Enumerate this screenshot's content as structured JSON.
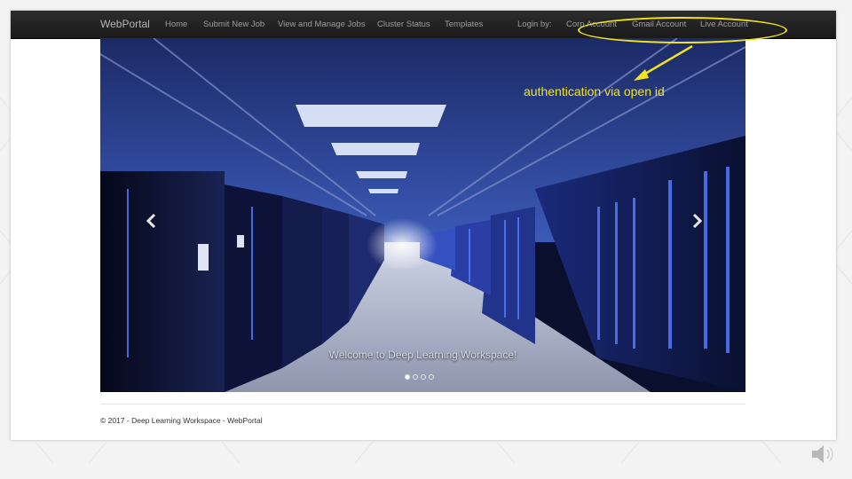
{
  "navbar": {
    "brand": "WebPortal",
    "items": [
      "Home",
      "Submit New Job",
      "View and Manage Jobs",
      "Cluster Status",
      "Templates"
    ],
    "login_label": "Login by:",
    "login_options": [
      "Corp Account",
      "Gmail Account",
      "Live Account"
    ]
  },
  "carousel": {
    "caption": "Welcome to Deep Learning Workspace!",
    "slide_count": 4,
    "active_slide": 1,
    "prev_icon": "chevron-left-icon",
    "next_icon": "chevron-right-icon"
  },
  "footer": {
    "text": "© 2017 - Deep Learning Workspace - WebPortal"
  },
  "annotation": {
    "text": "authentication via open id",
    "color": "#f5e60f"
  },
  "colors": {
    "navbar_bg": "#222222",
    "nav_text": "#9d9d9d",
    "server_light": "#3a5cff"
  }
}
